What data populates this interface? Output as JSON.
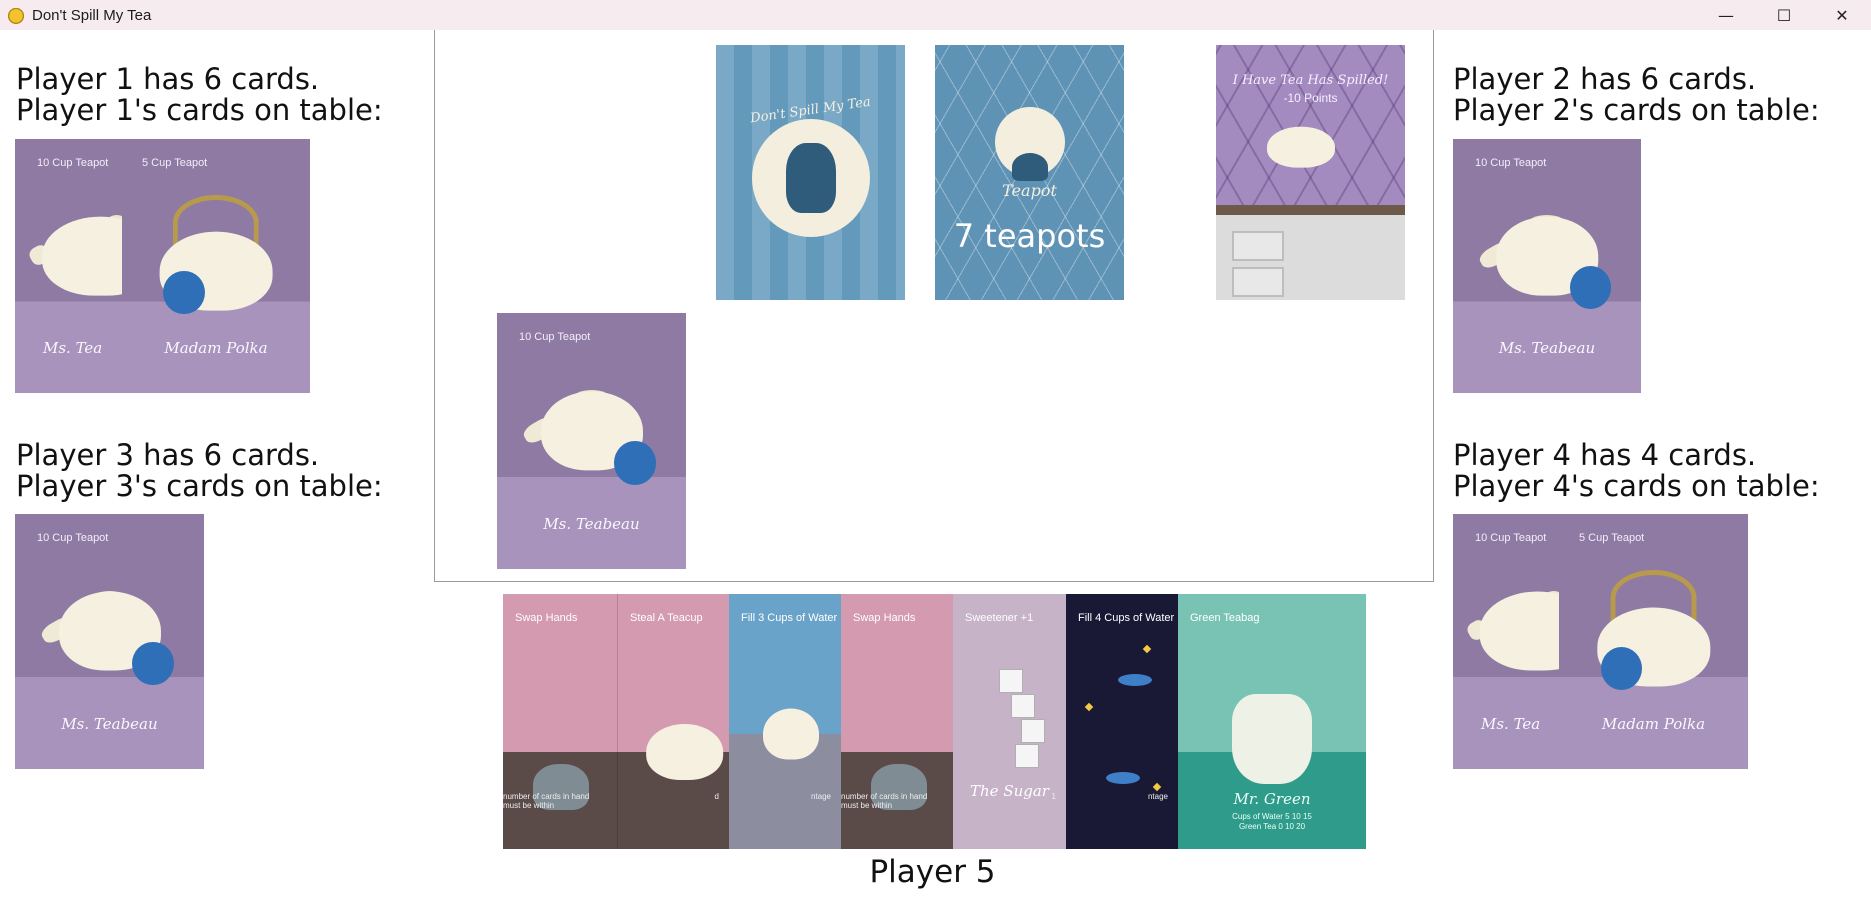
{
  "window": {
    "title": "Don't Spill My Tea",
    "controls": {
      "minimize": "—",
      "maximize": "☐",
      "close": "✕"
    }
  },
  "players": {
    "p1": {
      "count": "Player 1 has 6 cards.",
      "table": "Player 1's cards on table:",
      "cards": [
        {
          "cap": "10 Cup Teapot",
          "name": "Ms. Tea"
        },
        {
          "cap": "5 Cup Teapot",
          "name": "Madam Polka"
        }
      ]
    },
    "p2": {
      "count": "Player 2 has 6 cards.",
      "table": "Player 2's cards on table:",
      "cards": [
        {
          "cap": "10 Cup Teapot",
          "name": "Ms. Teabeau"
        }
      ]
    },
    "p3": {
      "count": "Player 3 has 6 cards.",
      "table": "Player 3's cards on table:",
      "cards": [
        {
          "cap": "10 Cup Teapot",
          "name": "Ms. Teabeau"
        }
      ]
    },
    "p4": {
      "count": "Player 4 has 4 cards.",
      "table": "Player 4's cards on table:",
      "cards": [
        {
          "cap": "10 Cup Teapot",
          "name": "Ms. Tea"
        },
        {
          "cap": "5 Cup Teapot",
          "name": "Madam Polka"
        }
      ]
    },
    "p5": {
      "label": "Player 5"
    }
  },
  "board": {
    "deck": {
      "title": "Don't Spill My Tea"
    },
    "pile": {
      "type": "Teapot",
      "count": "7 teapots"
    },
    "spilled": {
      "title": "I Have Tea Has Spilled!",
      "points": "-10 Points"
    },
    "played": {
      "cap": "10 Cup Teapot",
      "name": "Ms. Teabeau"
    }
  },
  "hand": [
    {
      "cap": "Swap Hands",
      "text": "number of cards in hand must be within"
    },
    {
      "cap": "Steal A Teacup",
      "text": "d"
    },
    {
      "cap": "Fill 3 Cups of Water",
      "text": "ntage"
    },
    {
      "cap": "Swap Hands",
      "text": "number of cards in hand must be within"
    },
    {
      "cap": "Sweetener +1",
      "name": "The Sugar",
      "text": "1"
    },
    {
      "cap": "Fill 4 Cups of Water",
      "text": "ntage"
    },
    {
      "cap": "Green Teabag",
      "name": "Mr. Green",
      "row1": "Cups of Water  5  10  15",
      "row2": "Green Tea  0  10  20"
    }
  ],
  "colors": {
    "teapot_card": "#8e7aa3",
    "deck_card": "#6399bb",
    "pile_card": "#5f93b5",
    "spilled_card": "#a38bc0",
    "green_card": "#2f9b8a",
    "space_card": "#191935"
  }
}
